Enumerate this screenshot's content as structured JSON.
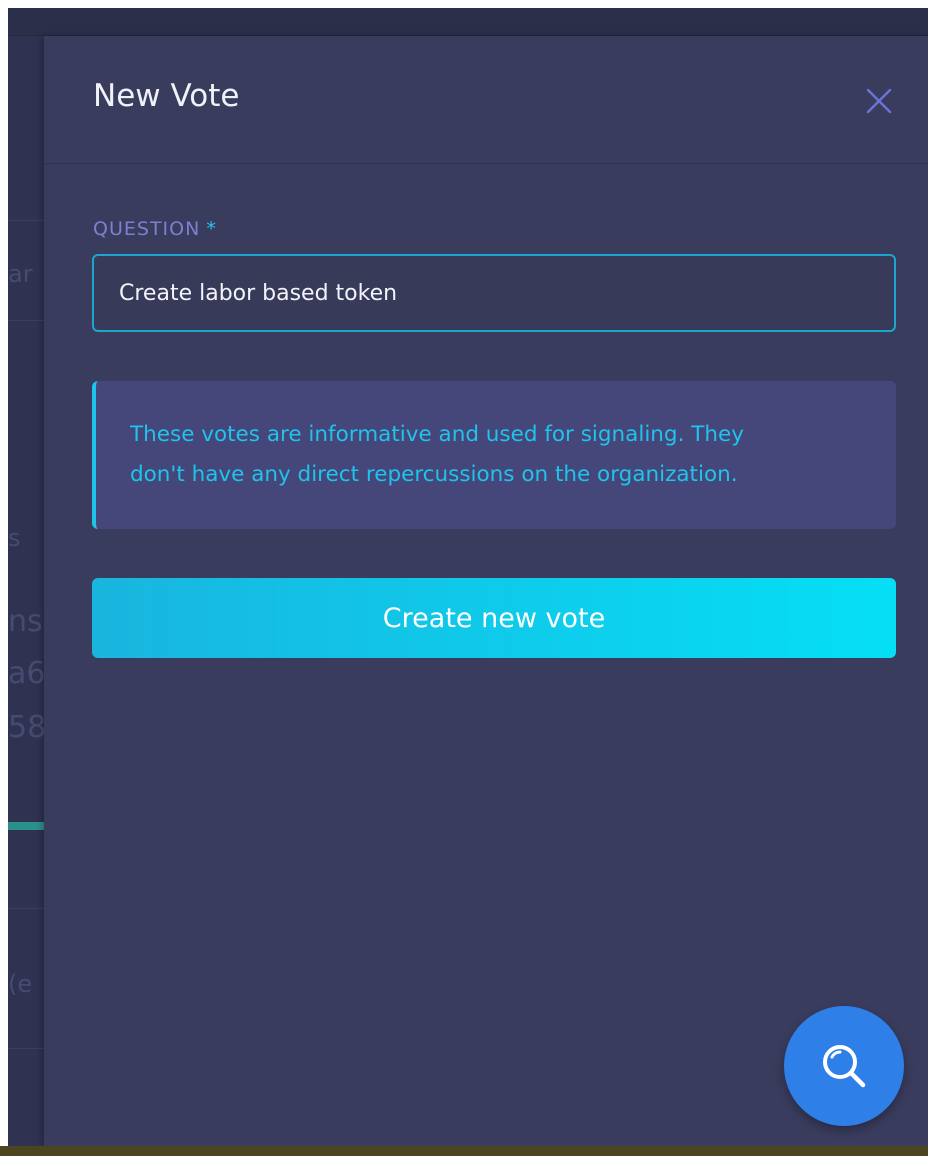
{
  "panel": {
    "title": "New Vote",
    "close_label": "close"
  },
  "question": {
    "label": "QUESTION",
    "required_marker": "*",
    "value": "Create labor based token",
    "placeholder": ""
  },
  "info": {
    "line1": "These votes are informative and used for signaling. They",
    "line2": "don't have any direct repercussions on the organization."
  },
  "actions": {
    "create_label": "Create new vote"
  },
  "fab": {
    "icon": "search-icon"
  },
  "background_fragments": [
    "ar",
    "s",
    "ns",
    "a6",
    "58",
    "(e"
  ],
  "colors": {
    "panel_bg": "#393c5d",
    "accent": "#1fc8ea",
    "label": "#7d7fd0",
    "info_bg": "#45477a",
    "fab_bg": "#2f7fe9"
  }
}
